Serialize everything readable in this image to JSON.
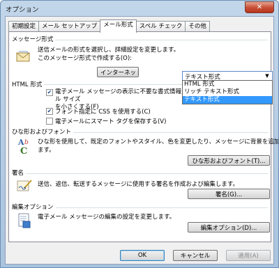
{
  "window": {
    "title": "オプション",
    "close": "✕"
  },
  "tabs": [
    "初期設定",
    "メール セットアップ",
    "メール形式",
    "スペル チェック",
    "その他"
  ],
  "message_format": {
    "title": "メッセージ形式",
    "desc1": "送信メールの形式を選択し、詳細設定を変更します。",
    "desc2": "このメッセージ形式で作成する(O):",
    "combo_value": "テキスト形式",
    "options": [
      "HTML 形式",
      "リッチ テキスト形式",
      "テキスト形式"
    ],
    "selected_option": "テキスト形式",
    "internet_button": "インターネット"
  },
  "html_format": {
    "title": "HTML 形式",
    "check1": "電子メール メッセージの表示に不要な書式情報を削除してメッセージのファイル サイズを小さくする(F)",
    "check1_line1": "電子メール メッセージの表示に不要な書式情報を削除してメッセージのファイル サイズ",
    "check1_line2": "を小さくする(F)",
    "check1_checked": true,
    "check2": "フォント指定に CSS を使用する(C)",
    "check2_checked": true,
    "check3": "電子メールにスマート タグを保存する(V)",
    "check3_checked": false
  },
  "stationery": {
    "title": "ひな形およびフォント",
    "desc1": "ひな形を使用して、既定のフォントやスタイル、色を変更したり、メッセージに背景を追加し",
    "desc2": "ます。",
    "button": "ひな形およびフォント(T)..."
  },
  "signature": {
    "title": "署名",
    "desc": "送信、返信、転送するメッセージに使用する署名を作成および編集します。",
    "button": "署名(G)..."
  },
  "editor_options": {
    "title": "編集オプション",
    "desc": "電子メール メッセージの編集の設定を変更します。",
    "button": "編集オプション(D)..."
  },
  "footer": {
    "ok": "OK",
    "cancel": "キャンセル",
    "apply": "適用(A)"
  },
  "colors": {
    "accent": "#3399ff",
    "titlebar": "#b7cde5",
    "close": "#c9533a"
  },
  "icons": [
    "envelope-icon",
    "font-abc-icon",
    "signature-pen-icon",
    "document-edit-icon",
    "check-icon",
    "dropdown-arrow-icon"
  ]
}
